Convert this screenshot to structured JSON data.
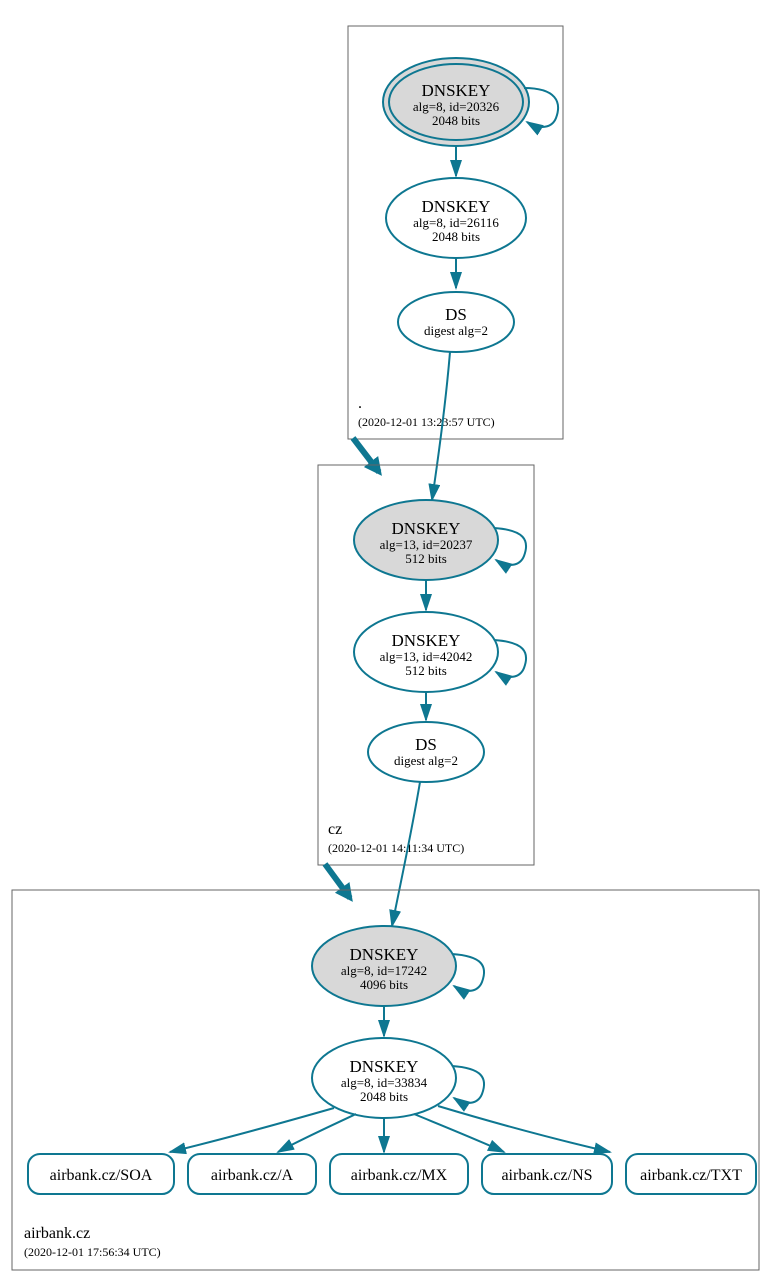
{
  "colors": {
    "accent": "#0e7791",
    "ksk_fill": "#d8d8d8"
  },
  "zones": [
    {
      "name": ".",
      "timestamp": "(2020-12-01 13:23:57 UTC)",
      "nodes": [
        {
          "id": "root-ksk",
          "type": "DNSKEY",
          "title": "DNSKEY",
          "line1": "alg=8, id=20326",
          "line2": "2048 bits",
          "ksk": true,
          "double_ring": true,
          "self_loop": true
        },
        {
          "id": "root-zsk",
          "type": "DNSKEY",
          "title": "DNSKEY",
          "line1": "alg=8, id=26116",
          "line2": "2048 bits",
          "ksk": false,
          "double_ring": false,
          "self_loop": false
        },
        {
          "id": "root-ds",
          "type": "DS",
          "title": "DS",
          "line1": "digest alg=2",
          "line2": "",
          "ksk": false,
          "double_ring": false,
          "self_loop": false
        }
      ]
    },
    {
      "name": "cz",
      "timestamp": "(2020-12-01 14:11:34 UTC)",
      "nodes": [
        {
          "id": "cz-ksk",
          "type": "DNSKEY",
          "title": "DNSKEY",
          "line1": "alg=13, id=20237",
          "line2": "512 bits",
          "ksk": true,
          "double_ring": false,
          "self_loop": true
        },
        {
          "id": "cz-zsk",
          "type": "DNSKEY",
          "title": "DNSKEY",
          "line1": "alg=13, id=42042",
          "line2": "512 bits",
          "ksk": false,
          "double_ring": false,
          "self_loop": true
        },
        {
          "id": "cz-ds",
          "type": "DS",
          "title": "DS",
          "line1": "digest alg=2",
          "line2": "",
          "ksk": false,
          "double_ring": false,
          "self_loop": false
        }
      ]
    },
    {
      "name": "airbank.cz",
      "timestamp": "(2020-12-01 17:56:34 UTC)",
      "nodes": [
        {
          "id": "ab-ksk",
          "type": "DNSKEY",
          "title": "DNSKEY",
          "line1": "alg=8, id=17242",
          "line2": "4096 bits",
          "ksk": true,
          "double_ring": false,
          "self_loop": true
        },
        {
          "id": "ab-zsk",
          "type": "DNSKEY",
          "title": "DNSKEY",
          "line1": "alg=8, id=33834",
          "line2": "2048 bits",
          "ksk": false,
          "double_ring": false,
          "self_loop": true
        }
      ],
      "rrsets": [
        {
          "id": "rr-soa",
          "label": "airbank.cz/SOA"
        },
        {
          "id": "rr-a",
          "label": "airbank.cz/A"
        },
        {
          "id": "rr-mx",
          "label": "airbank.cz/MX"
        },
        {
          "id": "rr-ns",
          "label": "airbank.cz/NS"
        },
        {
          "id": "rr-txt",
          "label": "airbank.cz/TXT"
        }
      ]
    }
  ]
}
